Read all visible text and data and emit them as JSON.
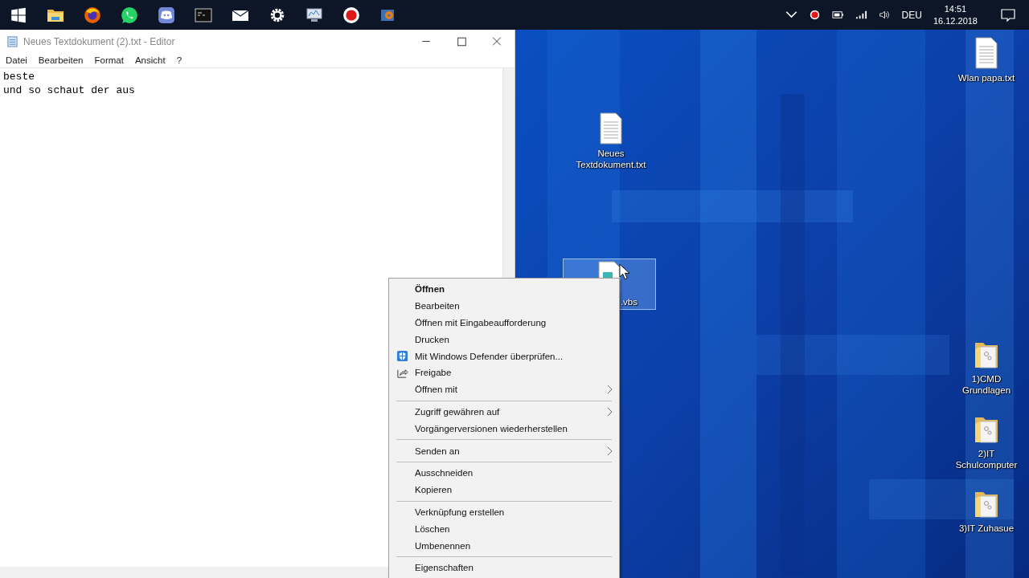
{
  "taskbar": {
    "apps": [
      {
        "kind": "start"
      },
      {
        "kind": "folder"
      },
      {
        "kind": "firefox"
      },
      {
        "kind": "whatsapp"
      },
      {
        "kind": "discord"
      },
      {
        "kind": "terminal"
      },
      {
        "kind": "mail"
      },
      {
        "kind": "settings"
      },
      {
        "kind": "monitor"
      },
      {
        "kind": "record"
      },
      {
        "kind": "media"
      }
    ],
    "tray": {
      "language": "DEU",
      "time": "14:51",
      "date": "16.12.2018"
    }
  },
  "editor": {
    "title": "Neues Textdokument (2).txt - Editor",
    "menu": [
      "Datei",
      "Bearbeiten",
      "Format",
      "Ansicht",
      "?"
    ],
    "lines": [
      "beste",
      "und so schaut der aus"
    ]
  },
  "desktop": {
    "icons": [
      {
        "label": "Neues Textdokument.txt",
        "kind": "text-file",
        "selected": false
      },
      {
        "label": "Wlan papa.txt",
        "kind": "text-file",
        "selected": false
      },
      {
        "label": ".vbs",
        "kind": "script-file",
        "selected": true
      },
      {
        "label": "1)CMD Grundlagen",
        "kind": "folder",
        "selected": false
      },
      {
        "label": "2)IT Schulcomputer",
        "kind": "folder",
        "selected": false
      },
      {
        "label": "3)IT Zuhasue",
        "kind": "folder",
        "selected": false
      }
    ]
  },
  "context_menu": {
    "items": [
      {
        "kind": "item",
        "label": "Öffnen",
        "default": true,
        "submenu": false
      },
      {
        "kind": "item",
        "label": "Bearbeiten",
        "default": false,
        "submenu": false
      },
      {
        "kind": "item",
        "label": "Öffnen mit Eingabeaufforderung",
        "default": false,
        "submenu": false
      },
      {
        "kind": "item",
        "label": "Drucken",
        "default": false,
        "submenu": false
      },
      {
        "kind": "shield-item",
        "label": "Mit Windows Defender überprüfen...",
        "default": false,
        "submenu": false
      },
      {
        "kind": "share-item",
        "label": "Freigabe",
        "default": false,
        "submenu": false
      },
      {
        "kind": "item",
        "label": "Öffnen mit",
        "default": false,
        "submenu": true
      },
      {
        "kind": "separator"
      },
      {
        "kind": "item",
        "label": "Zugriff gewähren auf",
        "default": false,
        "submenu": true
      },
      {
        "kind": "item",
        "label": "Vorgängerversionen wiederherstellen",
        "default": false,
        "submenu": false
      },
      {
        "kind": "separator"
      },
      {
        "kind": "item",
        "label": "Senden an",
        "default": false,
        "submenu": true
      },
      {
        "kind": "separator"
      },
      {
        "kind": "item",
        "label": "Ausschneiden",
        "default": false,
        "submenu": false
      },
      {
        "kind": "item",
        "label": "Kopieren",
        "default": false,
        "submenu": false
      },
      {
        "kind": "separator"
      },
      {
        "kind": "item",
        "label": "Verknüpfung erstellen",
        "default": false,
        "submenu": false
      },
      {
        "kind": "item",
        "label": "Löschen",
        "default": false,
        "submenu": false
      },
      {
        "kind": "item",
        "label": "Umbenennen",
        "default": false,
        "submenu": false
      },
      {
        "kind": "separator"
      },
      {
        "kind": "item",
        "label": "Eigenschaften",
        "default": false,
        "submenu": false
      }
    ]
  }
}
